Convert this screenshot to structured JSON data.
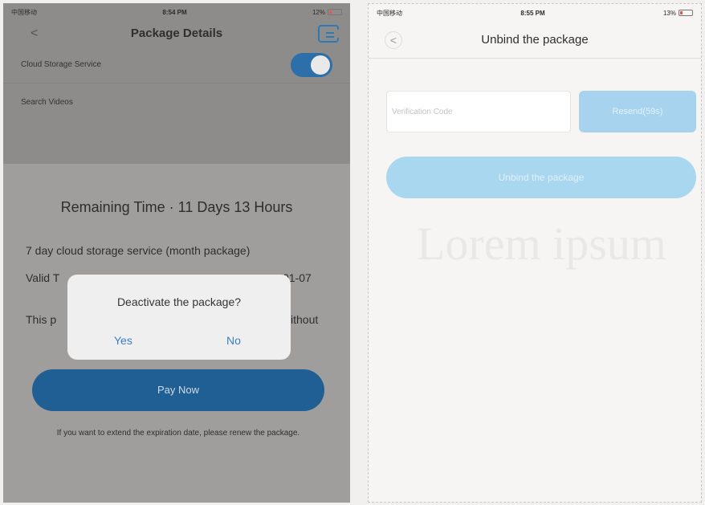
{
  "left": {
    "status": {
      "carrier": "中国移动",
      "time": "8:54 PM",
      "battery": "12%"
    },
    "header": {
      "back": "<",
      "title": "Package Details"
    },
    "rows": {
      "cloud_storage": "Cloud Storage Service",
      "search_videos": "Search Videos"
    },
    "remaining": "Remaining Time ·  11 Days 13 Hours",
    "package_name": "7 day cloud storage service (month package)",
    "valid_prefix": "Valid T",
    "valid_suffix": "01-07",
    "this_prefix": "This p",
    "this_suffix": "ithout",
    "pay_button": "Pay Now",
    "note": "If you want to extend the expiration date, please renew the package.",
    "dialog": {
      "question": "Deactivate the package?",
      "yes": "Yes",
      "no": "No"
    }
  },
  "right": {
    "status": {
      "carrier": "中国移动",
      "time": "8:55 PM",
      "battery": "13%"
    },
    "header": {
      "back": "<",
      "title": "Unbind the package"
    },
    "code_placeholder": "Verification Code",
    "resend": "Resend(59s)",
    "unbind_button": "Unbind the package"
  }
}
